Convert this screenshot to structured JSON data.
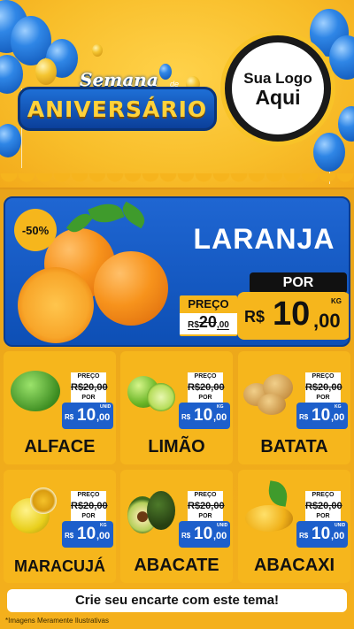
{
  "header": {
    "title_small": "Semana",
    "title_de": "de",
    "title_main": "ANIVERSÁRIO",
    "logo_line1": "Sua Logo",
    "logo_line2": "Aqui"
  },
  "colors": {
    "accent_yellow": "#f6b61c",
    "brand_blue": "#1d5fcb",
    "dark": "#111111"
  },
  "featured": {
    "name": "LARANJA",
    "discount": "-50%",
    "old_label": "PREÇO",
    "old_currency": "R$",
    "old_int": "20",
    "old_dec": ",00",
    "new_label": "POR",
    "new_currency": "R$",
    "new_int": "10",
    "new_dec": ",00",
    "unit": "KG"
  },
  "products": [
    {
      "name": "ALFACE",
      "old_label": "PREÇO",
      "old_price": "R$20,00",
      "new_label": "POR",
      "currency": "R$",
      "price_int": "10",
      "price_dec": ",00",
      "unit": "UNID"
    },
    {
      "name": "LIMÃO",
      "old_label": "PREÇO",
      "old_price": "R$20,00",
      "new_label": "POR",
      "currency": "R$",
      "price_int": "10",
      "price_dec": ",00",
      "unit": "KG"
    },
    {
      "name": "BATATA",
      "old_label": "PREÇO",
      "old_price": "R$20,00",
      "new_label": "POR",
      "currency": "R$",
      "price_int": "10",
      "price_dec": ",00",
      "unit": "KG"
    },
    {
      "name": "MARACUJÁ",
      "old_label": "PREÇO",
      "old_price": "R$20,00",
      "new_label": "POR",
      "currency": "R$",
      "price_int": "10",
      "price_dec": ",00",
      "unit": "KG"
    },
    {
      "name": "ABACATE",
      "old_label": "PREÇO",
      "old_price": "R$20,00",
      "new_label": "POR",
      "currency": "R$",
      "price_int": "10",
      "price_dec": ",00",
      "unit": "UNID"
    },
    {
      "name": "ABACAXI",
      "old_label": "PREÇO",
      "old_price": "R$20,00",
      "new_label": "POR",
      "currency": "R$",
      "price_int": "10",
      "price_dec": ",00",
      "unit": "UNID"
    }
  ],
  "footer": {
    "cta": "Crie seu encarte com este tema!",
    "disclaimer": "*Imagens Meramente Ilustrativas"
  }
}
